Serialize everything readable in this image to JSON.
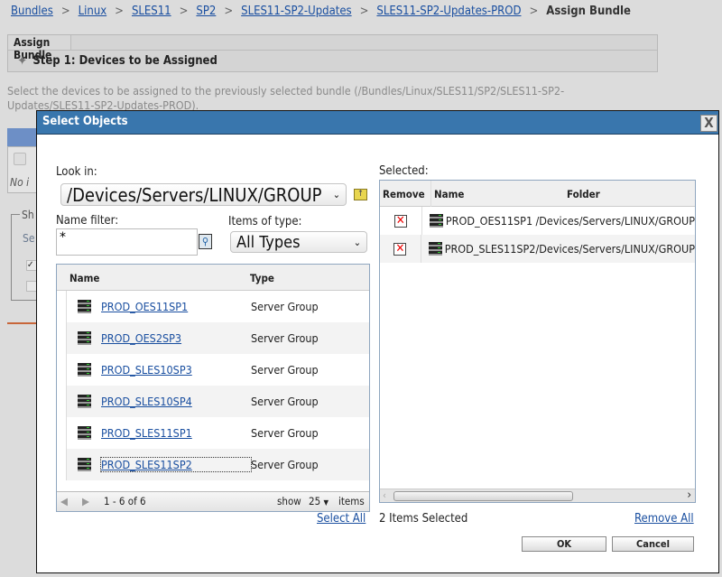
{
  "breadcrumb": {
    "items": [
      "Bundles",
      "Linux",
      "SLES11",
      "SP2",
      "SLES11-SP2-Updates",
      "SLES11-SP2-Updates-PROD"
    ],
    "current": "Assign Bundle"
  },
  "panel": {
    "tab": "Assign Bundle",
    "step": "Step 1: Devices to be Assigned"
  },
  "description": "Select the devices to be assigned to the previously selected bundle (/Bundles/Linux/SLES11/SP2/SLES11-SP2-Updates/SLES11-SP2-Updates-PROD).",
  "background": {
    "no_items": "No i",
    "fieldset_label": "Sh",
    "se": "Se"
  },
  "dialog": {
    "title": "Select Objects",
    "close": "X",
    "look_in_label": "Look in:",
    "look_in_value": "/Devices/Servers/LINUX/GROUP",
    "name_filter_label": "Name filter:",
    "name_filter_value": "*",
    "items_type_label": "Items of type:",
    "items_type_value": "All Types",
    "left_grid": {
      "headers": {
        "name": "Name",
        "type": "Type"
      },
      "rows": [
        {
          "name": "PROD_OES11SP1",
          "type": "Server Group"
        },
        {
          "name": "PROD_OES2SP3",
          "type": "Server Group"
        },
        {
          "name": "PROD_SLES10SP3",
          "type": "Server Group"
        },
        {
          "name": "PROD_SLES10SP4",
          "type": "Server Group"
        },
        {
          "name": "PROD_SLES11SP1",
          "type": "Server Group"
        },
        {
          "name": "PROD_SLES11SP2",
          "type": "Server Group"
        }
      ],
      "footer": {
        "range": "1 - 6 of 6",
        "show": "show",
        "page_size": "25",
        "items": "items"
      }
    },
    "selected_label": "Selected:",
    "right_grid": {
      "headers": {
        "remove": "Remove",
        "name": "Name",
        "folder": "Folder"
      },
      "rows": [
        {
          "name": "PROD_OES11SP1",
          "folder": "/Devices/Servers/LINUX/GROUP"
        },
        {
          "name": "PROD_SLES11SP2",
          "folder": "/Devices/Servers/LINUX/GROUP"
        }
      ]
    },
    "select_all": "Select All",
    "selected_count": "2 Items Selected",
    "remove_all": "Remove All",
    "ok": "OK",
    "cancel": "Cancel"
  }
}
